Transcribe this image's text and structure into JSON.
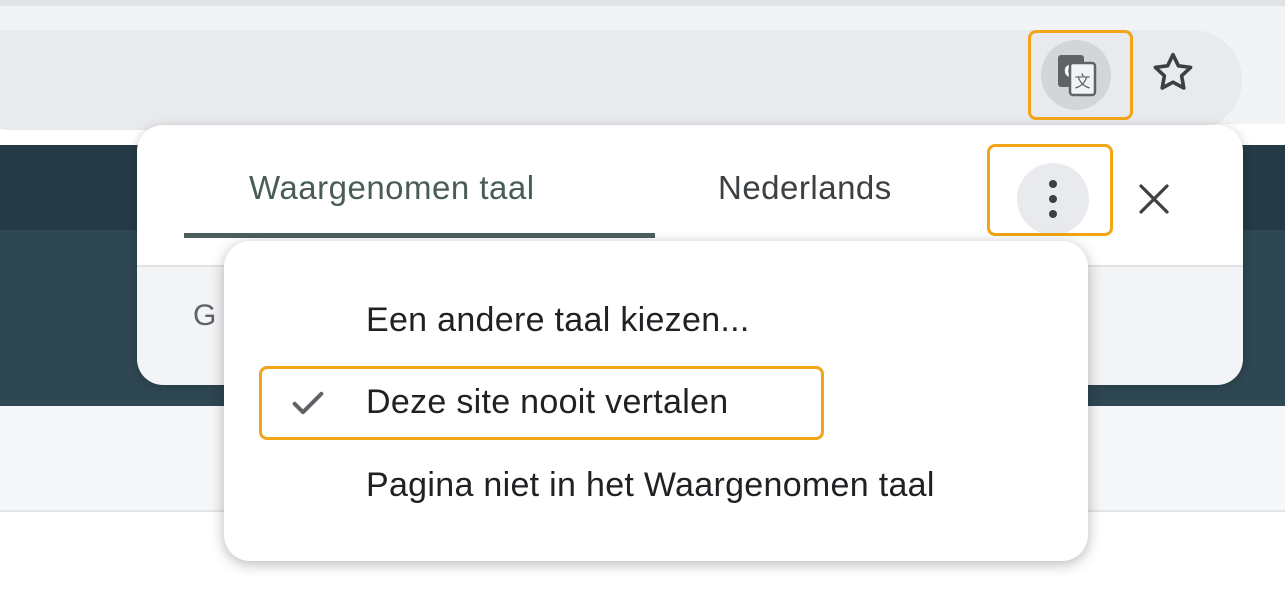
{
  "toolbar": {
    "translate_icon": "google-translate-icon",
    "bookmark_icon": "star-outline-icon"
  },
  "translate_bubble": {
    "tabs": [
      {
        "label": "Waargenomen taal",
        "active": true
      },
      {
        "label": "Nederlands",
        "active": false
      }
    ],
    "partial_text": "G",
    "more_icon": "vertical-dots-icon",
    "close_icon": "close-icon"
  },
  "options_menu": {
    "items": [
      {
        "label": "Een andere taal kiezen...",
        "checked": false
      },
      {
        "label": "Deze site nooit vertalen",
        "checked": true
      },
      {
        "label": "Pagina niet in het Waargenomen taal",
        "checked": false
      }
    ]
  },
  "colors": {
    "highlight": "#f2a516",
    "page_header_dark": "#243a45",
    "page_hero_dark": "#2e4752",
    "active_tab": "#4d5f5d"
  }
}
